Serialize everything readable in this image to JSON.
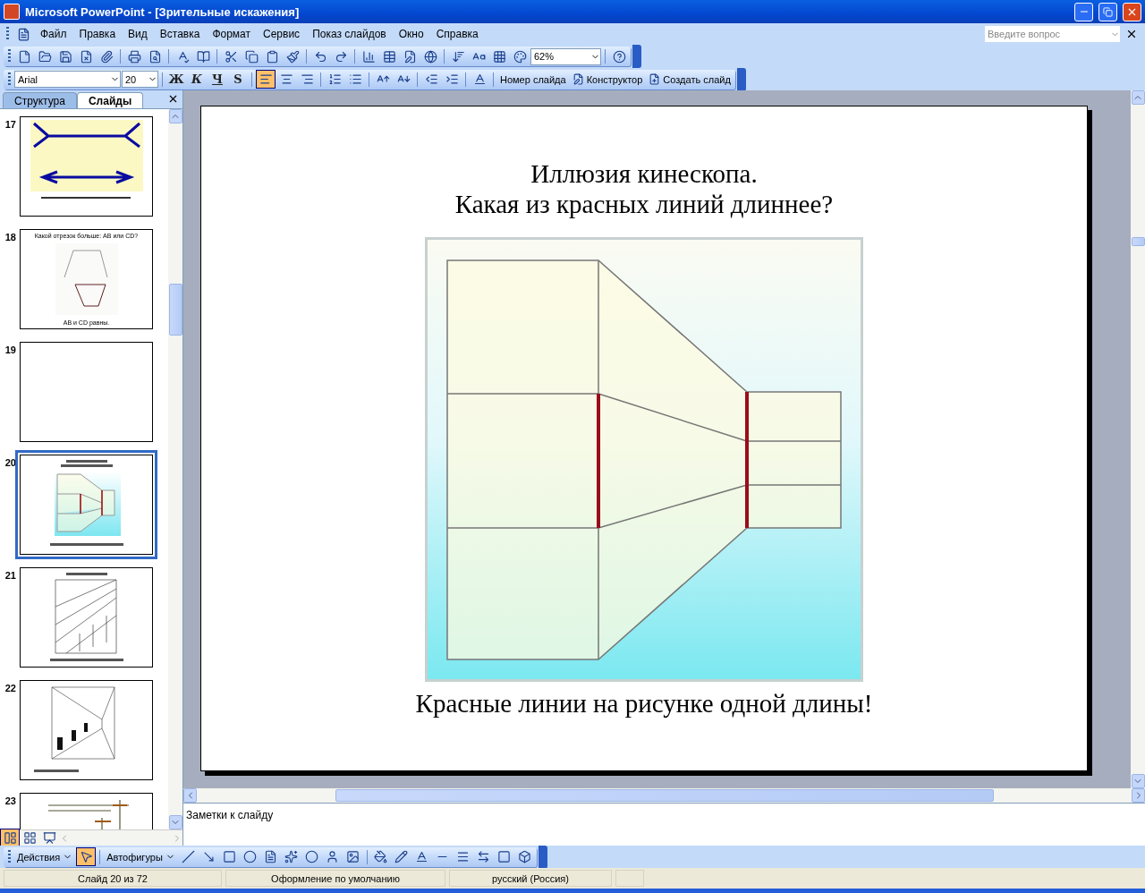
{
  "window": {
    "title": "Microsoft PowerPoint - [Зрительные искажения]"
  },
  "menu": [
    "Файл",
    "Правка",
    "Вид",
    "Вставка",
    "Формат",
    "Сервис",
    "Показ слайдов",
    "Окно",
    "Справка"
  ],
  "help_field": {
    "placeholder": "Введите вопрос"
  },
  "standard_toolbar": {
    "zoom": "62%"
  },
  "formatting_toolbar": {
    "font": "Arial",
    "size": "20",
    "styles": [
      "Ж",
      "К",
      "Ч",
      "S"
    ],
    "alignment": [
      {
        "selected": true
      },
      {
        "selected": false
      },
      {
        "selected": false
      }
    ],
    "buttons": [
      "Номер слайда",
      "Конструктор",
      "Создать слайд"
    ]
  },
  "pane_tabs": [
    {
      "label": "Структура",
      "selected": false
    },
    {
      "label": "Слайды",
      "selected": true
    }
  ],
  "slides": [
    {
      "number": "17",
      "kind": "arrows",
      "selected": false
    },
    {
      "number": "18",
      "kind": "segments",
      "selected": false,
      "title": "Какой отрезок больше: AB или CD?",
      "caption": "AB и CD равны."
    },
    {
      "number": "19",
      "kind": "blank",
      "selected": false
    },
    {
      "number": "20",
      "kind": "kinescope",
      "selected": true
    },
    {
      "number": "21",
      "kind": "columns",
      "selected": false
    },
    {
      "number": "22",
      "kind": "corridor",
      "selected": false
    },
    {
      "number": "23",
      "kind": "poles",
      "selected": false
    }
  ],
  "current_slide": {
    "title_lines": [
      "Иллюзия кинескопа.",
      "Какая из красных линий длиннее?"
    ],
    "caption": "Красные линии на рисунке одной длины!"
  },
  "notes": {
    "placeholder": "Заметки к слайду"
  },
  "drawing_toolbar": {
    "actions": "Действия",
    "select_tool": {
      "selected": true
    },
    "autoshapes": "Автофигуры"
  },
  "status_bar": [
    "Слайд 20 из 72",
    "Оформление по умолчанию",
    "русский (Россия)"
  ]
}
